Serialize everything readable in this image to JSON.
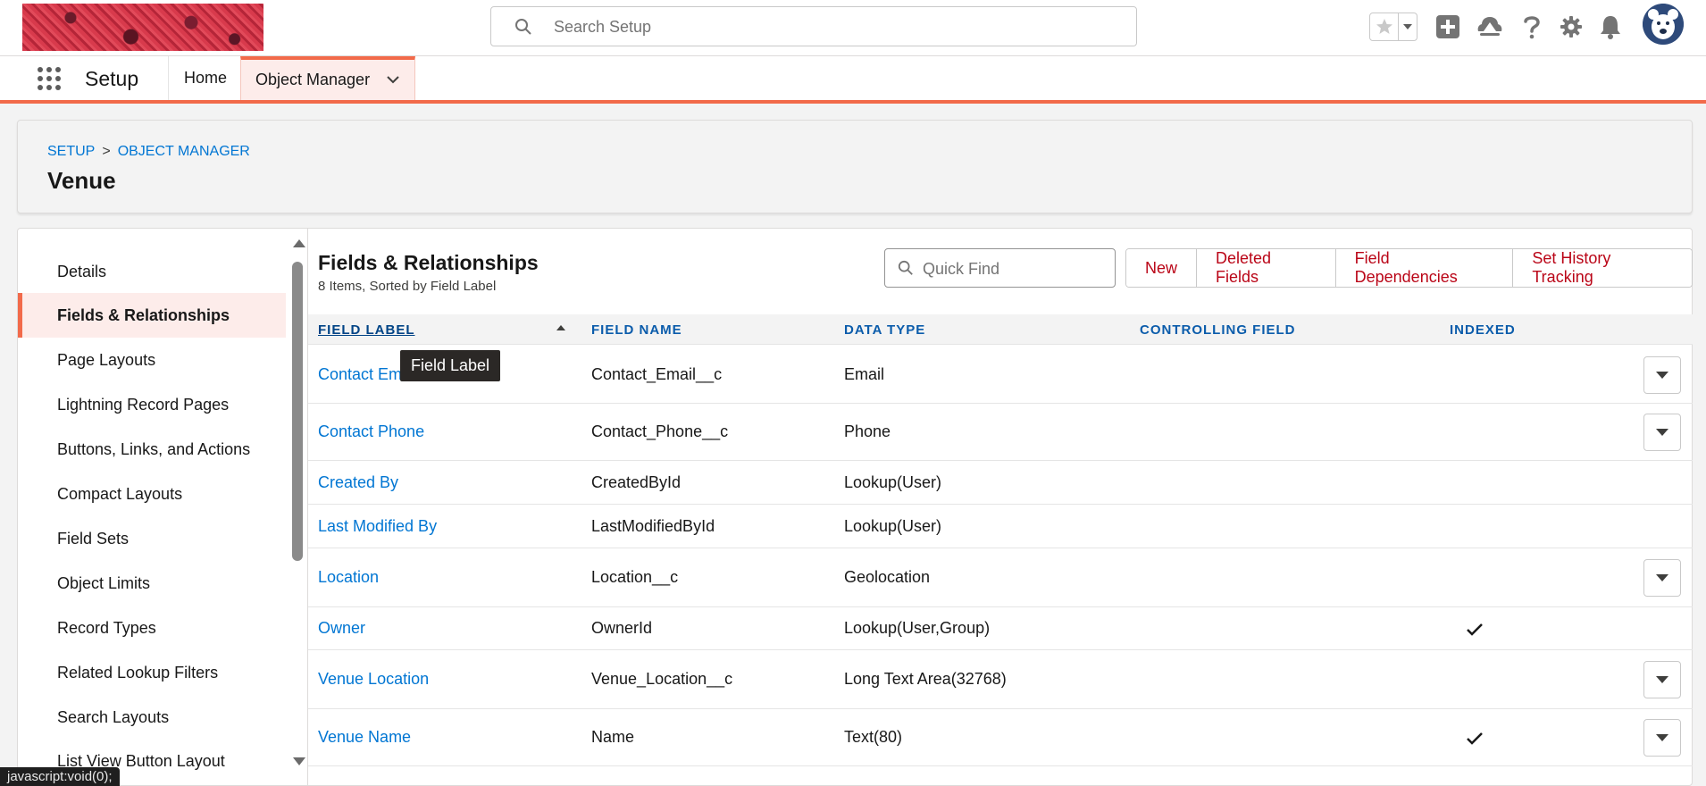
{
  "search": {
    "placeholder": "Search Setup"
  },
  "header_icons": [
    "star-icon",
    "chevron-down-icon",
    "plus-icon",
    "trailhead-icon",
    "help-icon",
    "gear-icon",
    "bell-icon",
    "avatar"
  ],
  "nav": {
    "app_name": "Setup",
    "tabs": [
      {
        "label": "Home"
      },
      {
        "label": "Object Manager"
      }
    ]
  },
  "page": {
    "breadcrumb": [
      "SETUP",
      ">",
      "OBJECT MANAGER"
    ],
    "title": "Venue"
  },
  "sidebar": {
    "items": [
      {
        "label": "Details"
      },
      {
        "label": "Fields & Relationships"
      },
      {
        "label": "Page Layouts"
      },
      {
        "label": "Lightning Record Pages"
      },
      {
        "label": "Buttons, Links, and Actions"
      },
      {
        "label": "Compact Layouts"
      },
      {
        "label": "Field Sets"
      },
      {
        "label": "Object Limits"
      },
      {
        "label": "Record Types"
      },
      {
        "label": "Related Lookup Filters"
      },
      {
        "label": "Search Layouts"
      },
      {
        "label": "List View Button Layout"
      }
    ]
  },
  "fields": {
    "title": "Fields & Relationships",
    "subtitle": "8 Items, Sorted by Field Label",
    "quick_find_placeholder": "Quick Find",
    "buttons": [
      "New",
      "Deleted Fields",
      "Field Dependencies",
      "Set History Tracking"
    ],
    "columns": [
      "FIELD LABEL",
      "FIELD NAME",
      "DATA TYPE",
      "CONTROLLING FIELD",
      "INDEXED"
    ],
    "rows": [
      {
        "label": "Contact Email",
        "name": "Contact_Email__c",
        "type": "Email",
        "controlling": "",
        "indexed": false,
        "action": true
      },
      {
        "label": "Contact Phone",
        "name": "Contact_Phone__c",
        "type": "Phone",
        "controlling": "",
        "indexed": false,
        "action": true
      },
      {
        "label": "Created By",
        "name": "CreatedById",
        "type": "Lookup(User)",
        "controlling": "",
        "indexed": false,
        "action": false
      },
      {
        "label": "Last Modified By",
        "name": "LastModifiedById",
        "type": "Lookup(User)",
        "controlling": "",
        "indexed": false,
        "action": false
      },
      {
        "label": "Location",
        "name": "Location__c",
        "type": "Geolocation",
        "controlling": "",
        "indexed": false,
        "action": true
      },
      {
        "label": "Owner",
        "name": "OwnerId",
        "type": "Lookup(User,Group)",
        "controlling": "",
        "indexed": true,
        "action": false
      },
      {
        "label": "Venue Location",
        "name": "Venue_Location__c",
        "type": "Long Text Area(32768)",
        "controlling": "",
        "indexed": false,
        "action": true
      },
      {
        "label": "Venue Name",
        "name": "Name",
        "type": "Text(80)",
        "controlling": "",
        "indexed": true,
        "action": true
      }
    ]
  },
  "tooltip": {
    "text": "Field Label"
  },
  "status_bar": {
    "text": "javascript:void(0);"
  },
  "colors": {
    "accent": "#f26a4a",
    "link": "#0176d3",
    "button_text": "#ba0517"
  }
}
